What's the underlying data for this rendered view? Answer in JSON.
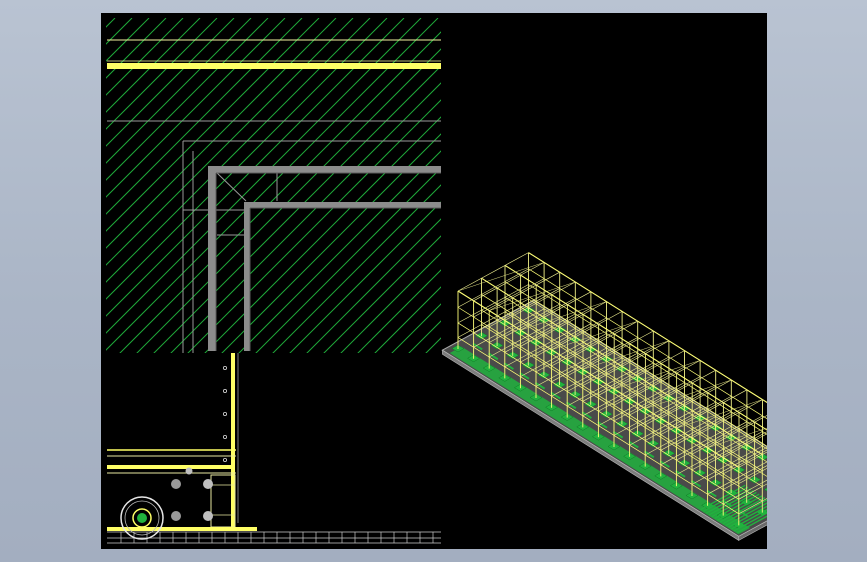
{
  "colors": {
    "background": "#a9b4c5",
    "viewport": "#000000",
    "primary_line": "#ffff66",
    "pale_line": "#ffffcc",
    "hatch": "#1fa83a",
    "green_fill": "#21b23e",
    "steel": "#8c8c8c",
    "construction": "#6e6e6e"
  },
  "views": {
    "left": {
      "name": "corner-section-detail"
    },
    "right": {
      "name": "isometric-frame-view"
    }
  }
}
